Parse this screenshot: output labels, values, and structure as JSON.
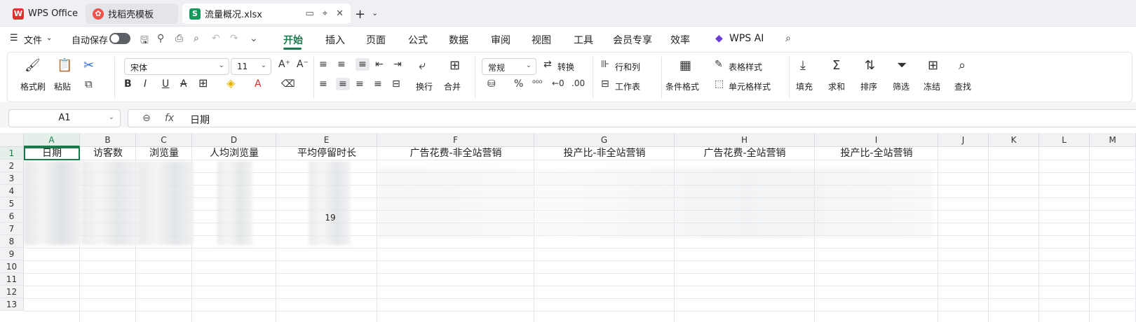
{
  "tabs": [
    {
      "label": "WPS Office",
      "icon": "W"
    },
    {
      "label": "找稻壳模板",
      "icon": "D"
    },
    {
      "label": "流量概况.xlsx",
      "icon": "S"
    }
  ],
  "menu": {
    "file": "文件",
    "autosave": "自动保存"
  },
  "ribbon_tabs": [
    "开始",
    "插入",
    "页面",
    "公式",
    "数据",
    "审阅",
    "视图",
    "工具",
    "会员专享",
    "效率",
    "WPS AI"
  ],
  "ribbon": {
    "format_painter": "格式刷",
    "paste": "粘贴",
    "font": "宋体",
    "font_size": "11",
    "wrap": "换行",
    "merge": "合并",
    "number_format": "常规",
    "convert": "转换",
    "row_col": "行和列",
    "worksheet": "工作表",
    "cond_format": "条件格式",
    "table_style": "表格样式",
    "cell_style": "单元格样式",
    "fill": "填充",
    "sum": "求和",
    "sort": "排序",
    "filter": "筛选",
    "freeze": "冻结",
    "find": "查找"
  },
  "formula_bar": {
    "name_box": "A1",
    "fx": "fx",
    "value": "日期"
  },
  "grid": {
    "columns": [
      "A",
      "B",
      "C",
      "D",
      "E",
      "F",
      "G",
      "H",
      "I",
      "J",
      "K",
      "L",
      "M"
    ],
    "rows": [
      "1",
      "2",
      "3",
      "4",
      "5",
      "6",
      "7",
      "8",
      "9",
      "10",
      "11",
      "12",
      "13"
    ],
    "header_row": [
      "日期",
      "访客数",
      "浏览量",
      "人均浏览量",
      "平均停留时长",
      "广告花费-非全站营销",
      "投产比-非全站营销",
      "广告花费-全站营销",
      "投产比-全站营销"
    ],
    "partial_text": "19"
  },
  "colors": {
    "accent": "#1a7a4c",
    "excel_green": "#129a5c",
    "wps_red": "#e0312f"
  }
}
